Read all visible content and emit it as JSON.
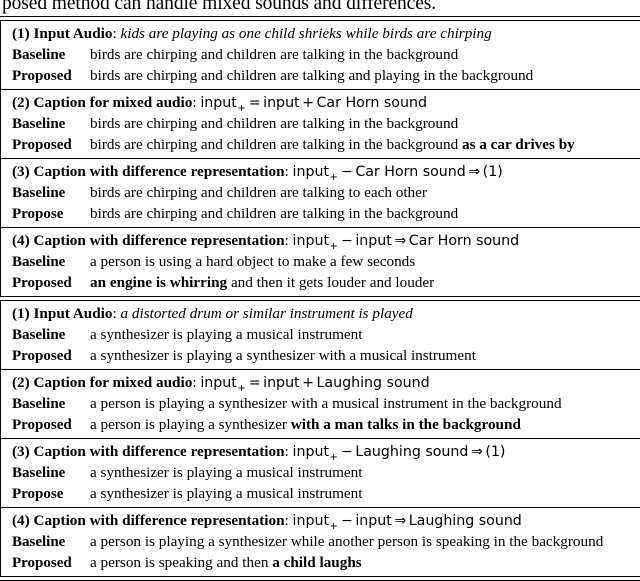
{
  "page_tail_text": "posed method can handle mixed sounds and differences.",
  "labels": {
    "baseline": "Baseline",
    "proposed": "Proposed",
    "propose": "Propose"
  },
  "examples": [
    {
      "id": "example-1",
      "sections": [
        {
          "id": "section-1-1",
          "num": "(1)",
          "title": "Input Audio",
          "head_kind": "italic-caption",
          "head_caption": "kids are playing as one child shrieks while birds are chirping",
          "rows": [
            {
              "label": "Baseline",
              "text_plain": "birds are chirping and children are talking in the background",
              "text_bold": ""
            },
            {
              "label": "Proposed",
              "text_plain": "birds are chirping and children are talking and playing in the background",
              "text_bold": ""
            }
          ]
        },
        {
          "id": "section-1-2",
          "num": "(2)",
          "title": "Caption for mixed audio",
          "head_kind": "math",
          "math_tokens": [
            {
              "t": "text",
              "v": "input"
            },
            {
              "t": "sub",
              "v": "+"
            },
            {
              "t": "op",
              "v": "="
            },
            {
              "t": "text",
              "v": "input"
            },
            {
              "t": "op",
              "v": "+"
            },
            {
              "t": "text",
              "v": "Car Horn sound"
            }
          ],
          "rows": [
            {
              "label": "Baseline",
              "text_plain": "birds are chirping and children are talking in the background",
              "text_bold": ""
            },
            {
              "label": "Proposed",
              "text_plain": "birds are chirping and children are talking in the background ",
              "text_bold": "as a car drives by"
            }
          ]
        },
        {
          "id": "section-1-3",
          "num": "(3)",
          "title": "Caption with difference representation",
          "head_kind": "math",
          "math_tokens": [
            {
              "t": "text",
              "v": "input"
            },
            {
              "t": "sub",
              "v": "+"
            },
            {
              "t": "op",
              "v": "−"
            },
            {
              "t": "text",
              "v": "Car Horn sound"
            },
            {
              "t": "op",
              "v": "⇒"
            },
            {
              "t": "text",
              "v": "(1)"
            }
          ],
          "rows": [
            {
              "label": "Baseline",
              "text_plain": "birds are chirping and children are talking to each other",
              "text_bold": ""
            },
            {
              "label": "Propose",
              "text_plain": "birds are chirping and children are talking in the background",
              "text_bold": ""
            }
          ]
        },
        {
          "id": "section-1-4",
          "num": "(4)",
          "title": "Caption with difference representation",
          "head_kind": "math",
          "math_tokens": [
            {
              "t": "text",
              "v": "input"
            },
            {
              "t": "sub",
              "v": "+"
            },
            {
              "t": "op",
              "v": "−"
            },
            {
              "t": "text",
              "v": "input"
            },
            {
              "t": "op",
              "v": "⇒"
            },
            {
              "t": "text",
              "v": "Car Horn sound"
            }
          ],
          "rows": [
            {
              "label": "Baseline",
              "text_plain": "a person is using a hard object to make a few seconds",
              "text_bold": ""
            },
            {
              "label": "Proposed",
              "text_plain": "",
              "text_bold": "an engine is whirring",
              "text_tail": " and then it gets louder and louder"
            }
          ]
        }
      ]
    },
    {
      "id": "example-2",
      "sections": [
        {
          "id": "section-2-1",
          "num": "(1)",
          "title": "Input Audio",
          "head_kind": "italic-caption",
          "head_caption": "a distorted drum or similar instrument is played",
          "rows": [
            {
              "label": "Baseline",
              "text_plain": "a synthesizer is playing a musical instrument",
              "text_bold": ""
            },
            {
              "label": "Proposed",
              "text_plain": "a synthesizer is playing a synthesizer with a musical instrument",
              "text_bold": ""
            }
          ]
        },
        {
          "id": "section-2-2",
          "num": "(2)",
          "title": "Caption for mixed audio",
          "head_kind": "math",
          "math_tokens": [
            {
              "t": "text",
              "v": "input"
            },
            {
              "t": "sub",
              "v": "+"
            },
            {
              "t": "op",
              "v": "="
            },
            {
              "t": "text",
              "v": "input"
            },
            {
              "t": "op",
              "v": "+"
            },
            {
              "t": "text",
              "v": "Laughing sound"
            }
          ],
          "rows": [
            {
              "label": "Baseline",
              "text_plain": "a person is playing a synthesizer with a musical instrument in the background",
              "text_bold": ""
            },
            {
              "label": "Proposed",
              "text_plain": "a person is playing a synthesizer ",
              "text_bold": "with a man talks in the background"
            }
          ]
        },
        {
          "id": "section-2-3",
          "num": "(3)",
          "title": "Caption with difference representation",
          "head_kind": "math",
          "math_tokens": [
            {
              "t": "text",
              "v": "input"
            },
            {
              "t": "sub",
              "v": "+"
            },
            {
              "t": "op",
              "v": "−"
            },
            {
              "t": "text",
              "v": "Laughing sound"
            },
            {
              "t": "op",
              "v": "⇒"
            },
            {
              "t": "text",
              "v": "(1)"
            }
          ],
          "rows": [
            {
              "label": "Baseline",
              "text_plain": "a synthesizer is playing a musical instrument",
              "text_bold": ""
            },
            {
              "label": "Propose",
              "text_plain": "a synthesizer is playing a musical instrument",
              "text_bold": ""
            }
          ]
        },
        {
          "id": "section-2-4",
          "num": "(4)",
          "title": "Caption with difference representation",
          "head_kind": "math",
          "math_tokens": [
            {
              "t": "text",
              "v": "input"
            },
            {
              "t": "sub",
              "v": "+"
            },
            {
              "t": "op",
              "v": "−"
            },
            {
              "t": "text",
              "v": "input"
            },
            {
              "t": "op",
              "v": "⇒"
            },
            {
              "t": "text",
              "v": "Laughing sound"
            }
          ],
          "rows": [
            {
              "label": "Baseline",
              "text_plain": "a person is playing a synthesizer while another person is speaking in the background",
              "text_bold": ""
            },
            {
              "label": "Proposed",
              "text_plain": "a person is speaking and then ",
              "text_bold": "a child laughs"
            }
          ]
        }
      ]
    }
  ]
}
